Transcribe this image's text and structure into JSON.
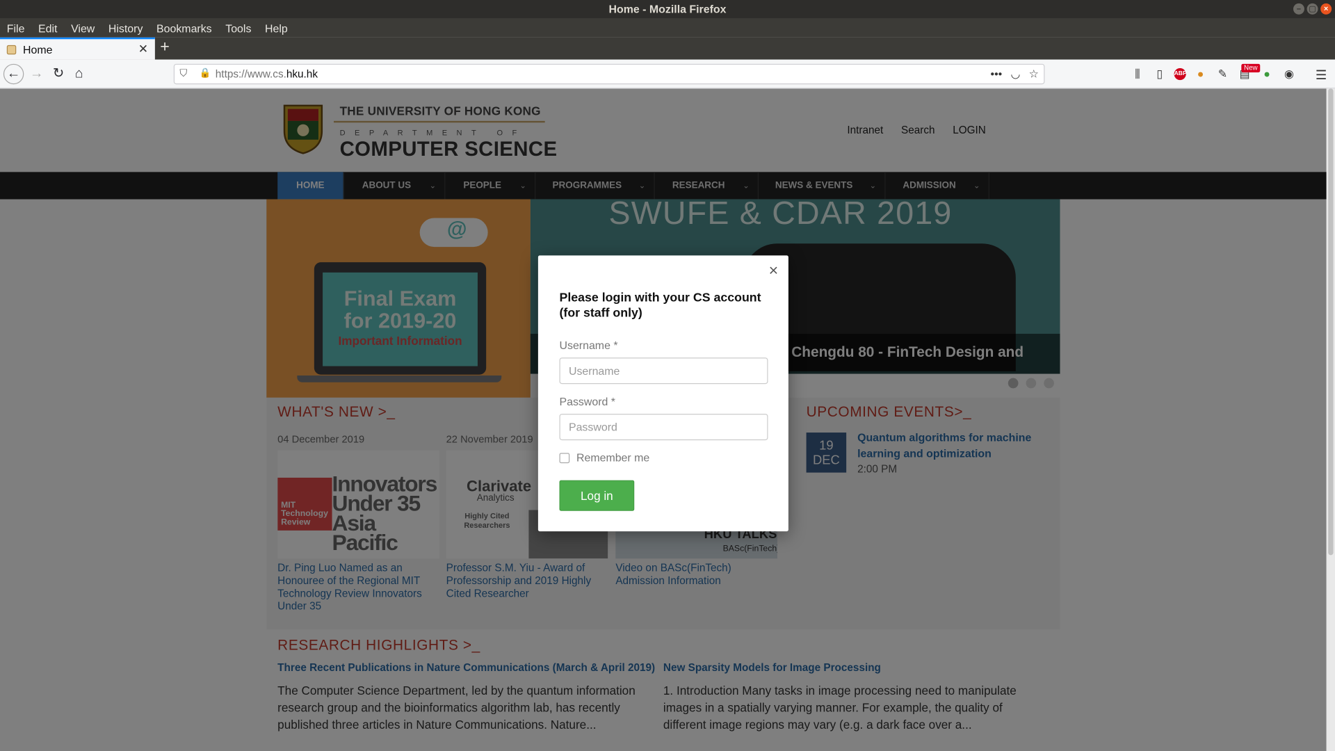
{
  "window": {
    "title": "Home - Mozilla Firefox"
  },
  "menu": [
    "File",
    "Edit",
    "View",
    "History",
    "Bookmarks",
    "Tools",
    "Help"
  ],
  "tab": {
    "label": "Home"
  },
  "url": {
    "prefix": "https://www.cs.",
    "domain": "hku.hk"
  },
  "toolbar": {
    "new_badge": "New"
  },
  "site": {
    "university": "THE UNIVERSITY OF HONG KONG",
    "department_label": "DEPARTMENT OF",
    "department_name": "COMPUTER SCIENCE",
    "top_links": [
      "Intranet",
      "Search",
      "LOGIN"
    ],
    "nav": [
      "HOME",
      "ABOUT US",
      "PEOPLE",
      "PROGRAMMES",
      "RESEARCH",
      "NEWS & EVENTS",
      "ADMISSION"
    ]
  },
  "hero": {
    "promo_line1": "Final Exam",
    "promo_line2": "for 2019-20",
    "promo_line3": "Important Information",
    "promo_icon": "@",
    "photo_heading": "SWUFE & CDAR 2019",
    "caption": "he Chengdu 80 - FinTech Design and"
  },
  "whats_new": {
    "heading": "WHAT'S NEW >_",
    "items": [
      {
        "date": "04 December 2019",
        "link": "Dr. Ping Luo Named as an Honouree of the Regional MIT Technology Review Innovators Under 35",
        "img_a": "MIT Technology Review",
        "img_b": "Innovators Under 35 Asia Pacific"
      },
      {
        "date": "22 November 2019",
        "link": "Professor S.M. Yiu - Award of Professorship and 2019 Highly Cited Researcher",
        "img_a": "Clarivate",
        "img_b": "Analytics",
        "img_c": "Highly Cited Researchers"
      },
      {
        "date": "",
        "link": "Video on BASc(FinTech) Admission Information",
        "img_a": "HKU TALKS",
        "img_b": "BASc(FinTech)"
      }
    ]
  },
  "events": {
    "heading": "UPCOMING EVENTS>_",
    "day": "19",
    "month": "DEC",
    "title": "Quantum algorithms for machine learning and optimization",
    "time": "2:00 PM"
  },
  "research": {
    "heading": "RESEARCH HIGHLIGHTS >_",
    "items": [
      {
        "title": "Three Recent Publications in Nature Communications (March & April 2019)",
        "body": "The Computer Science Department, led by the quantum information research group and the bioinformatics algorithm lab, has recently published three articles in Nature Communications. Nature..."
      },
      {
        "title": "New Sparsity Models for Image Processing",
        "body": "1. Introduction Many tasks in image processing need to manipulate images in a spatially varying manner. For example, the quality of different image regions may vary (e.g. a dark face over a..."
      }
    ]
  },
  "modal": {
    "close": "×",
    "title": "Please login with your CS account (for staff only)",
    "username_label": "Username *",
    "username_placeholder": "Username",
    "username_value": "",
    "password_label": "Password *",
    "password_placeholder": "Password",
    "password_value": "",
    "remember_label": "Remember me",
    "login_label": "Log in"
  }
}
